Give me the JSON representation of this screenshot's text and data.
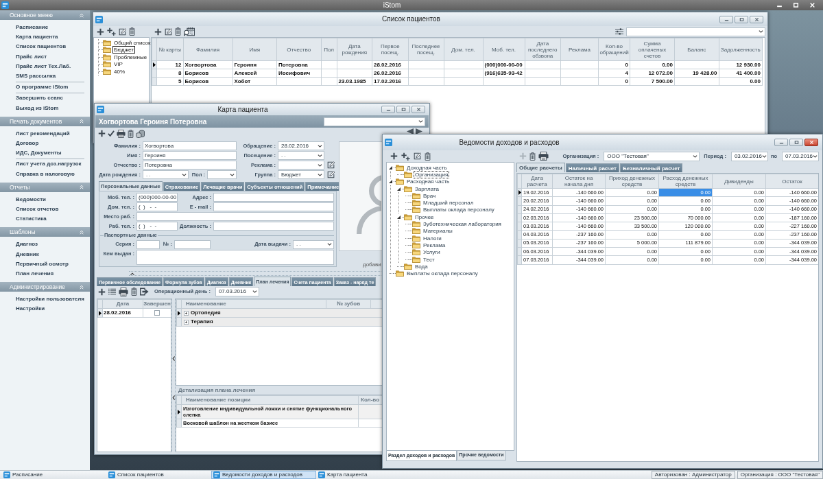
{
  "app": {
    "title": "iStom"
  },
  "sidebar": {
    "sections": [
      {
        "title": "Основное меню",
        "expanded": true,
        "groups": [
          [
            "Расписание",
            "Карта пациента",
            "Список пациентов",
            "Прайс лист",
            "Прайс лист Тех.Лаб.",
            "SMS рассылка"
          ],
          [
            "О программе iStom"
          ],
          [
            "Завершить сеанс",
            "Выход из iStom"
          ]
        ]
      },
      {
        "title": "Печать документов",
        "expanded": true,
        "groups": [
          [
            "Лист рекомендаций",
            "Договор",
            "ИДС, Документы"
          ],
          [
            "Лист учета доз.нагрузок",
            "Справка в налоговую"
          ]
        ]
      },
      {
        "title": "Отчеты",
        "expanded": true,
        "groups": [
          [
            "Ведомости",
            "Список отчетов",
            "Статистика"
          ]
        ]
      },
      {
        "title": "Шаблоны",
        "expanded": true,
        "groups": [
          [
            "Диагноз",
            "Дневник",
            "Первичный осмотр",
            "План лечения"
          ]
        ]
      },
      {
        "title": "Администрирование",
        "expanded": true,
        "groups": [
          [
            "Настройки пользователя",
            "Настройки"
          ]
        ]
      }
    ]
  },
  "patient_list": {
    "window": {
      "title": "Список пациентов",
      "active": false
    },
    "groups": [
      {
        "label": "Общий список",
        "selected": false
      },
      {
        "label": "Бюджет",
        "selected": true
      },
      {
        "label": "Проблемные",
        "selected": false
      },
      {
        "label": "VIP",
        "selected": false
      },
      {
        "label": "40%",
        "selected": false
      }
    ],
    "table": {
      "columns": [
        "№ карты",
        "Фамилия",
        "Имя",
        "Отчество",
        "Пол",
        "Дата рождения",
        "Первое посещ.",
        "Последнее посещ.",
        "Дом. тел.",
        "Моб. тел.",
        "Дата последнего обзвона",
        "Реклама",
        "Кол-во обращений",
        "Сумма оплаченых счетов",
        "Баланс",
        "Задолженность"
      ],
      "rows": [
        {
          "selected": true,
          "cells": [
            "12",
            "Хогвортова",
            "Героиня",
            "Потеровна",
            null,
            null,
            "28.02.2016",
            null,
            null,
            "(000)000-00-00",
            null,
            null,
            "0",
            "0.00",
            null,
            "12 930.00"
          ]
        },
        {
          "selected": false,
          "cells": [
            "8",
            "Борисов",
            "Алексей",
            "Иосифович",
            null,
            null,
            "26.02.2016",
            null,
            null,
            "(916)635-93-42",
            null,
            null,
            "4",
            "12 072.00",
            "19 428.00",
            "41 400.00"
          ]
        },
        {
          "selected": false,
          "cells": [
            "5",
            "Борисов",
            "Хобот",
            null,
            null,
            "23.03.1985",
            "17.02.2016",
            null,
            null,
            null,
            null,
            null,
            "0",
            "7 500.00",
            null,
            "0.00"
          ]
        }
      ]
    }
  },
  "patient_card": {
    "window": {
      "title": "Карта пациента",
      "active": false
    },
    "patient_name": "Хогвортова Героиня Потеровна",
    "identity": [
      {
        "label": "Фамилия :",
        "value": "Хогвортова"
      },
      {
        "label": "Имя :",
        "value": "Героиня"
      },
      {
        "label": "Отчество :",
        "value": "Потеровна"
      }
    ],
    "birth_date": {
      "label": "Дата рождения :",
      "value": ". ."
    },
    "sex": {
      "label": "Пол :"
    },
    "visit": [
      {
        "label": "Обращение :",
        "value": "28.02.2016",
        "edit_button": false
      },
      {
        "label": "Посещение :",
        "value": ". .",
        "edit_button": false
      },
      {
        "label": "Реклама :",
        "edit_button": true
      },
      {
        "label": "Группа :",
        "value": "Бюджет",
        "edit_button": true
      }
    ],
    "photo": {
      "caption": "добави"
    },
    "tabs": [
      {
        "label": "Персональные данные",
        "selected": true
      },
      {
        "label": "Страхование",
        "selected": false
      },
      {
        "label": "Лечащие врачи",
        "selected": false
      },
      {
        "label": "Субъекты отношений",
        "selected": false
      },
      {
        "label": "Примечание",
        "selected": false
      }
    ],
    "contact_rows": [
      [
        {
          "label": "Моб. тел. :",
          "value": "(000)000-00-00"
        },
        {
          "label": "Адрес :"
        }
      ],
      [
        {
          "label": "Дом. тел. :",
          "value": "(  )   -  -"
        },
        {
          "label": "E - mail :"
        }
      ],
      [
        {
          "label": "Место раб. :"
        }
      ],
      [
        {
          "label": "Раб. тел. :",
          "value": "(  )   -  -"
        },
        {
          "label": "Должность :"
        }
      ]
    ],
    "passport": {
      "title": "Паспортные данные",
      "series": {
        "label": "Серия :"
      },
      "number": {
        "label": "№ :"
      },
      "issue_date": {
        "label": "Дата выдачи :",
        "value": ". ."
      },
      "issued_by": {
        "label": "Кем выдан :"
      }
    },
    "record_tabs": [
      {
        "label": "Первичное обследование",
        "selected": false
      },
      {
        "label": "Формула зубов",
        "selected": false
      },
      {
        "label": "Диагноз",
        "selected": false
      },
      {
        "label": "Дневник",
        "selected": false
      },
      {
        "label": "План лечения",
        "selected": true
      },
      {
        "label": "Счета пациента",
        "selected": false
      },
      {
        "label": "Заказ - наряд те",
        "selected": false
      }
    ],
    "operational_day": {
      "label": "Операционный день :",
      "value": "07.03.2016"
    },
    "plans": {
      "columns": [
        "Дата",
        "Завершен"
      ],
      "rows": [
        {
          "selected": true,
          "date": "28.02.2016",
          "completed": false
        }
      ]
    },
    "plan_items": {
      "columns": [
        "Наименование",
        "№ зубов"
      ],
      "rows": [
        {
          "selected": true,
          "expanded": false,
          "name": "Ортопедия"
        },
        {
          "selected": false,
          "expanded": false,
          "name": "Терапия"
        }
      ]
    },
    "plan_details": {
      "title": "Детализация плана лечения",
      "columns": [
        "Наименование позиции",
        "Кол-во"
      ],
      "rows": [
        {
          "selected": true,
          "name": "Изготовление индивидуальной ложки и снятие функционального слепка"
        },
        {
          "selected": false,
          "name": "Восковой шаблон на жестком базисе"
        }
      ]
    }
  },
  "statements": {
    "window": {
      "title": "Ведомости доходов и расходов",
      "active": true
    },
    "tree": [
      {
        "label": "Доходная часть",
        "expanded": true,
        "selected": false,
        "children": [
          {
            "label": "Организация",
            "selected": true
          }
        ]
      },
      {
        "label": "Расходная часть",
        "expanded": true,
        "selected": false,
        "children": [
          {
            "label": "Зарплата",
            "expanded": true,
            "selected": false,
            "children": [
              {
                "label": "Врач",
                "selected": false
              },
              {
                "label": "Младший персонал",
                "selected": false
              },
              {
                "label": "Выплаты оклада персоналу",
                "selected": false
              }
            ]
          },
          {
            "label": "Прочее",
            "expanded": true,
            "selected": false,
            "children": [
              {
                "label": "Зуботехническая лаборатория",
                "selected": false
              },
              {
                "label": "Материалы",
                "selected": false
              },
              {
                "label": "Налоги",
                "selected": false
              },
              {
                "label": "Реклама",
                "selected": false
              },
              {
                "label": "Услуги",
                "selected": false
              },
              {
                "label": "Тест",
                "selected": false
              }
            ]
          },
          {
            "label": "Вода",
            "selected": false
          }
        ]
      },
      {
        "label": "Выплаты оклада персоналу",
        "selected": false
      }
    ],
    "bottom_tabs": [
      {
        "label": "Раздел доходов и расходов",
        "selected": true
      },
      {
        "label": "Прочие ведомости",
        "selected": false
      }
    ],
    "add_button": {
      "disabled": true
    },
    "organization": {
      "label": "Организация :",
      "value": "ООО \"Тестовая\""
    },
    "period": {
      "label": "Период :",
      "from": "03.02.2016",
      "to_label": "по",
      "to": "07.03.2016"
    },
    "tabs": [
      {
        "label": "Общие расчеты",
        "selected": true
      },
      {
        "label": "Наличный расчет",
        "selected": false
      },
      {
        "label": "Безналичный расчет",
        "selected": false
      }
    ],
    "table": {
      "columns": [
        "Дата расчета",
        "Остаток на начала дня",
        "Приход денежных средств",
        "Расход денежных средств",
        "Дивиденды",
        "Остаток"
      ],
      "rows": [
        {
          "selected": true,
          "cells": [
            {
              "text": "19.02.2016",
              "selected": false
            },
            {
              "text": "-140 660.00",
              "selected": false
            },
            {
              "text": "0.00",
              "selected": false
            },
            {
              "text": "0.00",
              "selected": true
            },
            {
              "text": "0.00",
              "selected": false
            },
            {
              "text": "-140 660.00",
              "selected": false
            }
          ]
        },
        {
          "selected": false,
          "cells": [
            {
              "text": "20.02.2016",
              "selected": false
            },
            {
              "text": "-140 660.00",
              "selected": false
            },
            {
              "text": "0.00",
              "selected": false
            },
            {
              "text": "0.00",
              "selected": false
            },
            {
              "text": "0.00",
              "selected": false
            },
            {
              "text": "-140 660.00",
              "selected": false
            }
          ]
        },
        {
          "selected": false,
          "cells": [
            {
              "text": "24.02.2016",
              "selected": false
            },
            {
              "text": "-140 660.00",
              "selected": false
            },
            {
              "text": "0.00",
              "selected": false
            },
            {
              "text": "0.00",
              "selected": false
            },
            {
              "text": "0.00",
              "selected": false
            },
            {
              "text": "-140 660.00",
              "selected": false
            }
          ]
        },
        {
          "selected": false,
          "cells": [
            {
              "text": "02.03.2016",
              "selected": false
            },
            {
              "text": "-140 660.00",
              "selected": false
            },
            {
              "text": "23 500.00",
              "selected": false
            },
            {
              "text": "70 000.00",
              "selected": false
            },
            {
              "text": "0.00",
              "selected": false
            },
            {
              "text": "-187 160.00",
              "selected": false
            }
          ]
        },
        {
          "selected": false,
          "cells": [
            {
              "text": "03.03.2016",
              "selected": false
            },
            {
              "text": "-140 660.00",
              "selected": false
            },
            {
              "text": "33 500.00",
              "selected": false
            },
            {
              "text": "120 000.00",
              "selected": false
            },
            {
              "text": "0.00",
              "selected": false
            },
            {
              "text": "-227 160.00",
              "selected": false
            }
          ]
        },
        {
          "selected": false,
          "cells": [
            {
              "text": "04.03.2016",
              "selected": false
            },
            {
              "text": "-237 160.00",
              "selected": false
            },
            {
              "text": "0.00",
              "selected": false
            },
            {
              "text": "0.00",
              "selected": false
            },
            {
              "text": "0.00",
              "selected": false
            },
            {
              "text": "-237 160.00",
              "selected": false
            }
          ]
        },
        {
          "selected": false,
          "cells": [
            {
              "text": "05.03.2016",
              "selected": false
            },
            {
              "text": "-237 160.00",
              "selected": false
            },
            {
              "text": "5 000.00",
              "selected": false
            },
            {
              "text": "111 879.00",
              "selected": false
            },
            {
              "text": "0.00",
              "selected": false
            },
            {
              "text": "-344 039.00",
              "selected": false
            }
          ]
        },
        {
          "selected": false,
          "cells": [
            {
              "text": "06.03.2016",
              "selected": false
            },
            {
              "text": "-344 039.00",
              "selected": false
            },
            {
              "text": "0.00",
              "selected": false
            },
            {
              "text": "0.00",
              "selected": false
            },
            {
              "text": "0.00",
              "selected": false
            },
            {
              "text": "-344 039.00",
              "selected": false
            }
          ]
        },
        {
          "selected": false,
          "cells": [
            {
              "text": "07.03.2016",
              "selected": false
            },
            {
              "text": "-344 039.00",
              "selected": false
            },
            {
              "text": "0.00",
              "selected": false
            },
            {
              "text": "0.00",
              "selected": false
            },
            {
              "text": "0.00",
              "selected": false
            },
            {
              "text": "-344 039.00",
              "selected": false
            }
          ]
        }
      ]
    }
  },
  "taskbar": {
    "items": [
      {
        "label": "Расписание",
        "selected": false
      },
      {
        "label": "Список пациентов",
        "selected": false
      },
      {
        "label": "Ведомости доходов и расходов",
        "selected": true
      },
      {
        "label": "Карта пациента",
        "selected": false
      }
    ],
    "status": [
      "Авторизован : Администратор",
      "Организация : ООО \"Тестовая\""
    ]
  }
}
